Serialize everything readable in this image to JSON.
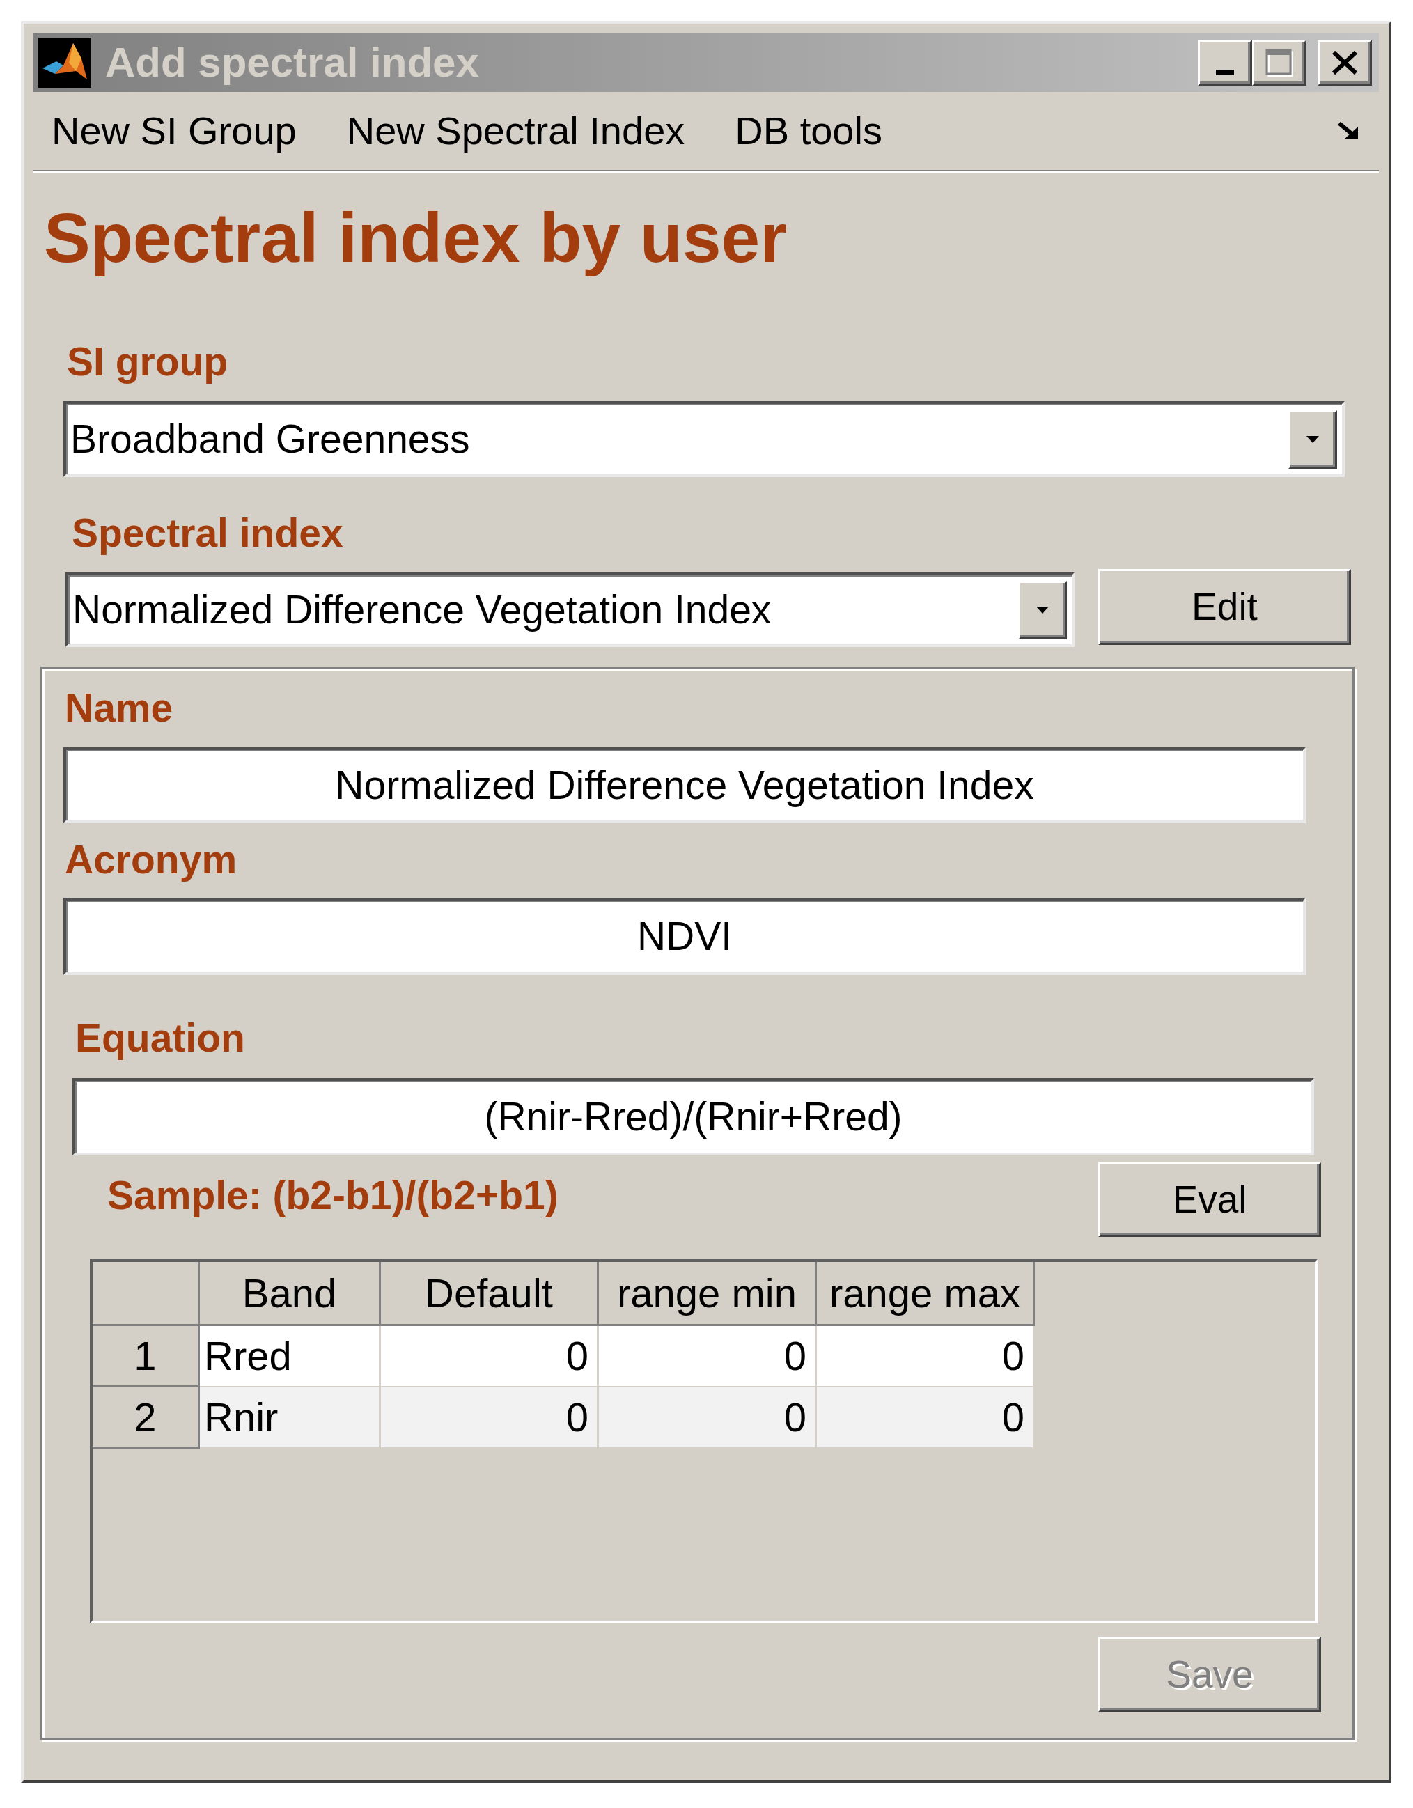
{
  "window": {
    "title": "Add spectral index",
    "controls": [
      {
        "kind": "minimize",
        "disabled": false
      },
      {
        "kind": "maximize",
        "disabled": true
      },
      {
        "kind": "close",
        "disabled": false
      }
    ]
  },
  "menu_bar": [
    "New SI Group",
    "New Spectral Index",
    "DB tools"
  ],
  "heading": "Spectral index by user",
  "si_group": {
    "label": "SI group",
    "value": "Broadband Greenness"
  },
  "spectral_index": {
    "label": "Spectral index",
    "value": "Normalized Difference Vegetation Index",
    "edit_button": "Edit"
  },
  "details": {
    "name": {
      "label": "Name",
      "value": "Normalized Difference Vegetation Index"
    },
    "acronym": {
      "label": "Acronym",
      "value": "NDVI"
    },
    "equation": {
      "label": "Equation",
      "value": "(Rnir-Rred)/(Rnir+Rred)"
    },
    "sample": "Sample: (b2-b1)/(b2+b1)",
    "eval_button": "Eval",
    "table": {
      "columns": [
        "Band",
        "Default",
        "range min",
        "range max"
      ],
      "rows": [
        {
          "number": "1",
          "cells": [
            "Rred",
            "0",
            "0",
            "0"
          ]
        },
        {
          "number": "2",
          "cells": [
            "Rnir",
            "0",
            "0",
            "0"
          ]
        }
      ]
    },
    "save_button": {
      "label": "Save",
      "disabled": true
    }
  }
}
